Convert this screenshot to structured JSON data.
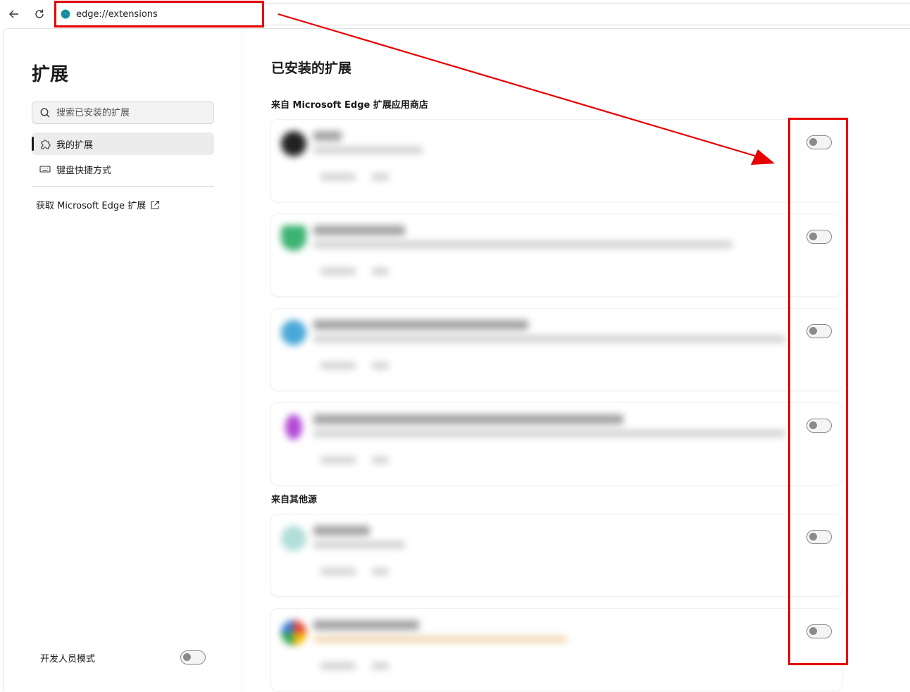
{
  "browser": {
    "address": "edge://extensions"
  },
  "sidebar": {
    "title": "扩展",
    "search_placeholder": "搜索已安装的扩展",
    "items": [
      {
        "label": "我的扩展",
        "active": true,
        "icon": "puzzle-icon"
      },
      {
        "label": "键盘快捷方式",
        "active": false,
        "icon": "keyboard-icon"
      }
    ],
    "get_extensions_link": "获取 Microsoft Edge 扩展",
    "developer_mode_label": "开发人员模式",
    "developer_mode_on": false
  },
  "main": {
    "title": "已安装的扩展",
    "section_store": "来自 Microsoft Edge 扩展应用商店",
    "section_other": "来自其他源",
    "extensions_store": [
      {
        "enabled": false,
        "icon_color": "#222222",
        "blurred": true
      },
      {
        "enabled": false,
        "icon_color": "#3cb371",
        "blurred": true
      },
      {
        "enabled": false,
        "icon_color": "#4aa8d8",
        "blurred": true
      },
      {
        "enabled": false,
        "icon_color": "#b34bd6",
        "blurred": true
      }
    ],
    "extensions_other": [
      {
        "enabled": false,
        "icon_color": "#7fc8c0",
        "blurred": true
      },
      {
        "enabled": false,
        "icon_color": "#3a7bd5",
        "blurred": true
      }
    ]
  },
  "annotations": {
    "color": "#e60000",
    "note": "highlight address bar and all extension toggles (all off)"
  }
}
